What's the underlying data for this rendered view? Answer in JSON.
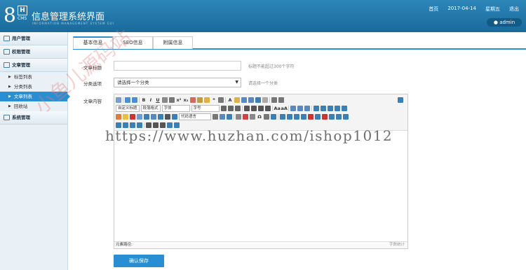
{
  "header": {
    "logo_number": "8",
    "logo_letter": "H",
    "logo_cms": "CMS",
    "title": "信息管理系统界面",
    "subtitle": "INFORMATION MANAGEMENT SYSTEM GUI",
    "links": [
      "首页",
      "2017-04-14",
      "星期五",
      "退出"
    ],
    "user": "admin"
  },
  "sidebar": {
    "groups": [
      {
        "label": "用户管理",
        "items": []
      },
      {
        "label": "权限管理",
        "items": []
      },
      {
        "label": "文章管理",
        "items": [
          {
            "label": "标签列表",
            "active": false
          },
          {
            "label": "分类列表",
            "active": false
          },
          {
            "label": "文章列表",
            "active": true
          },
          {
            "label": "回收站",
            "active": false
          }
        ]
      },
      {
        "label": "系统管理",
        "items": []
      }
    ]
  },
  "tabs": [
    {
      "label": "基本信息",
      "active": true
    },
    {
      "label": "SEO信息",
      "active": false
    },
    {
      "label": "附属信息",
      "active": false
    }
  ],
  "form": {
    "title_label": "文章标题",
    "title_value": "",
    "title_hint": "标题不能超过300个字符",
    "category_label": "分类选项",
    "category_selected": "请选择一个分类",
    "category_hint": "请选择一个分类",
    "content_label": "文章内容"
  },
  "editor": {
    "font_format": "自定义标题",
    "paragraph": "段落格式",
    "font_family": "字体",
    "font_size": "字号",
    "code_lang": "代码语言",
    "status_left": "元素路径:",
    "status_right": "字数统计"
  },
  "save_button": "确认保存",
  "watermark": {
    "url": "https://www.huzhan.com/ishop1012",
    "diagonal": "小鱼儿源码站"
  },
  "colors": {
    "header": "#1f77ab",
    "accent": "#2a8fd2",
    "sidebar_bg": "#eaf1f6"
  }
}
